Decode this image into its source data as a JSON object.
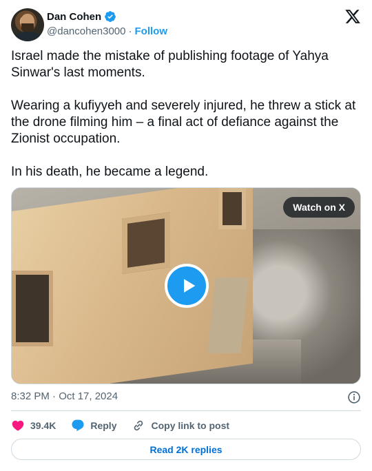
{
  "author": {
    "display_name": "Dan Cohen",
    "handle": "@dancohen3000",
    "separator": "·",
    "follow_label": "Follow"
  },
  "tweet": {
    "paragraphs": [
      "Israel made the mistake of publishing footage of Yahya Sinwar's last moments.",
      "Wearing a kufiyyeh and severely injured, he threw a stick at the drone filming him – a final act of defiance against the Zionist occupation.",
      "In his death, he became a legend."
    ],
    "timestamp": "8:32 PM · Oct 17, 2024"
  },
  "media": {
    "watch_label": "Watch on X"
  },
  "actions": {
    "likes": "39.4K",
    "reply_label": "Reply",
    "copy_label": "Copy link to post"
  },
  "footer": {
    "read_replies_label": "Read 2K replies"
  },
  "colors": {
    "accent": "#1d9bf0",
    "like": "#f91880",
    "secondary_text": "#536471",
    "link": "#006fd6"
  },
  "icons": [
    "verified-badge-icon",
    "x-logo-icon",
    "play-icon",
    "info-icon",
    "heart-icon",
    "reply-icon",
    "link-icon"
  ]
}
